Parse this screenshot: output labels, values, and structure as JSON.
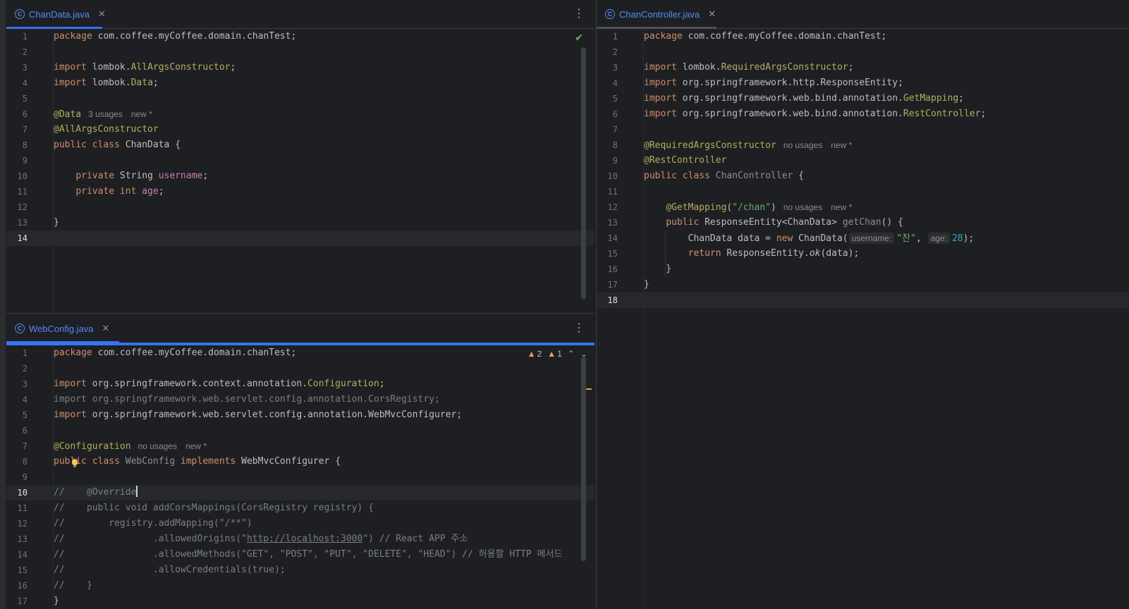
{
  "panes": {
    "top_left": {
      "tab": {
        "name": "ChanData.java",
        "file_icon": "c-class-icon"
      },
      "lines": [
        [
          "1",
          "package com.coffee.myCoffee.domain.chanTest;"
        ],
        [
          "2",
          ""
        ],
        [
          "3",
          "import lombok.AllArgsConstructor;"
        ],
        [
          "4",
          "import lombok.Data;"
        ],
        [
          "5",
          ""
        ],
        [
          "6",
          "@Data"
        ],
        [
          "7",
          "@AllArgsConstructor"
        ],
        [
          "8",
          "public class ChanData {"
        ],
        [
          "9",
          ""
        ],
        [
          "10",
          "    private String username;"
        ],
        [
          "11",
          "    private int age;"
        ],
        [
          "12",
          ""
        ],
        [
          "13",
          "}"
        ],
        [
          "14",
          ""
        ]
      ],
      "hints": {
        "line6_usages": "3 usages",
        "line6_new": "new *"
      }
    },
    "bottom_left": {
      "tab": {
        "name": "WebConfig.java",
        "file_icon": "c-class-icon"
      },
      "warnings": {
        "warnings_count": "2",
        "weak_count": "1"
      },
      "lines": [
        [
          "1",
          "package com.coffee.myCoffee.domain.chanTest;"
        ],
        [
          "2",
          ""
        ],
        [
          "3",
          "import org.springframework.context.annotation.Configuration;"
        ],
        [
          "4",
          "import org.springframework.web.servlet.config.annotation.CorsRegistry;"
        ],
        [
          "5",
          "import org.springframework.web.servlet.config.annotation.WebMvcConfigurer;"
        ],
        [
          "6",
          ""
        ],
        [
          "7",
          "@Configuration"
        ],
        [
          "8",
          "public class WebConfig implements WebMvcConfigurer {"
        ],
        [
          "9",
          ""
        ],
        [
          "10",
          "//    @Override"
        ],
        [
          "11",
          "//    public void addCorsMappings(CorsRegistry registry) {"
        ],
        [
          "12",
          "//        registry.addMapping(\"/**\")"
        ],
        [
          "13",
          "//                .allowedOrigins(\"http://localhost:3000\") // React APP 주소"
        ],
        [
          "14",
          "//                .allowedMethods(\"GET\", \"POST\", \"PUT\", \"DELETE\", \"HEAD\") // 허용할 HTTP 메서드"
        ],
        [
          "15",
          "//                .allowCredentials(true);"
        ],
        [
          "16",
          "//    }"
        ],
        [
          "17",
          "}"
        ]
      ],
      "hints": {
        "line7_usages": "no usages",
        "line7_new": "new *"
      }
    },
    "right": {
      "tab": {
        "name": "ChanController.java",
        "file_icon": "c-class-icon"
      },
      "lines": [
        [
          "1",
          "package com.coffee.myCoffee.domain.chanTest;"
        ],
        [
          "2",
          ""
        ],
        [
          "3",
          "import lombok.RequiredArgsConstructor;"
        ],
        [
          "4",
          "import org.springframework.http.ResponseEntity;"
        ],
        [
          "5",
          "import org.springframework.web.bind.annotation.GetMapping;"
        ],
        [
          "6",
          "import org.springframework.web.bind.annotation.RestController;"
        ],
        [
          "7",
          ""
        ],
        [
          "8",
          "@RequiredArgsConstructor"
        ],
        [
          "9",
          "@RestController"
        ],
        [
          "10",
          "public class ChanController {"
        ],
        [
          "11",
          ""
        ],
        [
          "12",
          "    @GetMapping(\"/chan\")"
        ],
        [
          "13",
          "    public ResponseEntity<ChanData> getChan() {"
        ],
        [
          "14",
          "        ChanData data = new ChanData(\"찬\", 28);"
        ],
        [
          "15",
          "        return ResponseEntity.ok(data);"
        ],
        [
          "16",
          "    }"
        ],
        [
          "17",
          "}"
        ],
        [
          "18",
          ""
        ]
      ],
      "hints": {
        "line8_usages": "no usages",
        "line8_new": "new *",
        "line12_usages": "no usages",
        "line12_new": "new *",
        "param_username": "username:",
        "param_age": "age:"
      }
    }
  },
  "colors": {
    "accent": "#3574f0",
    "background": "#1e1f22",
    "keyword": "#cf8e6d",
    "annotation": "#b3ae60",
    "string": "#6aab73",
    "field": "#c77dbb",
    "number": "#2aacb8",
    "comment": "#7a7e85"
  }
}
